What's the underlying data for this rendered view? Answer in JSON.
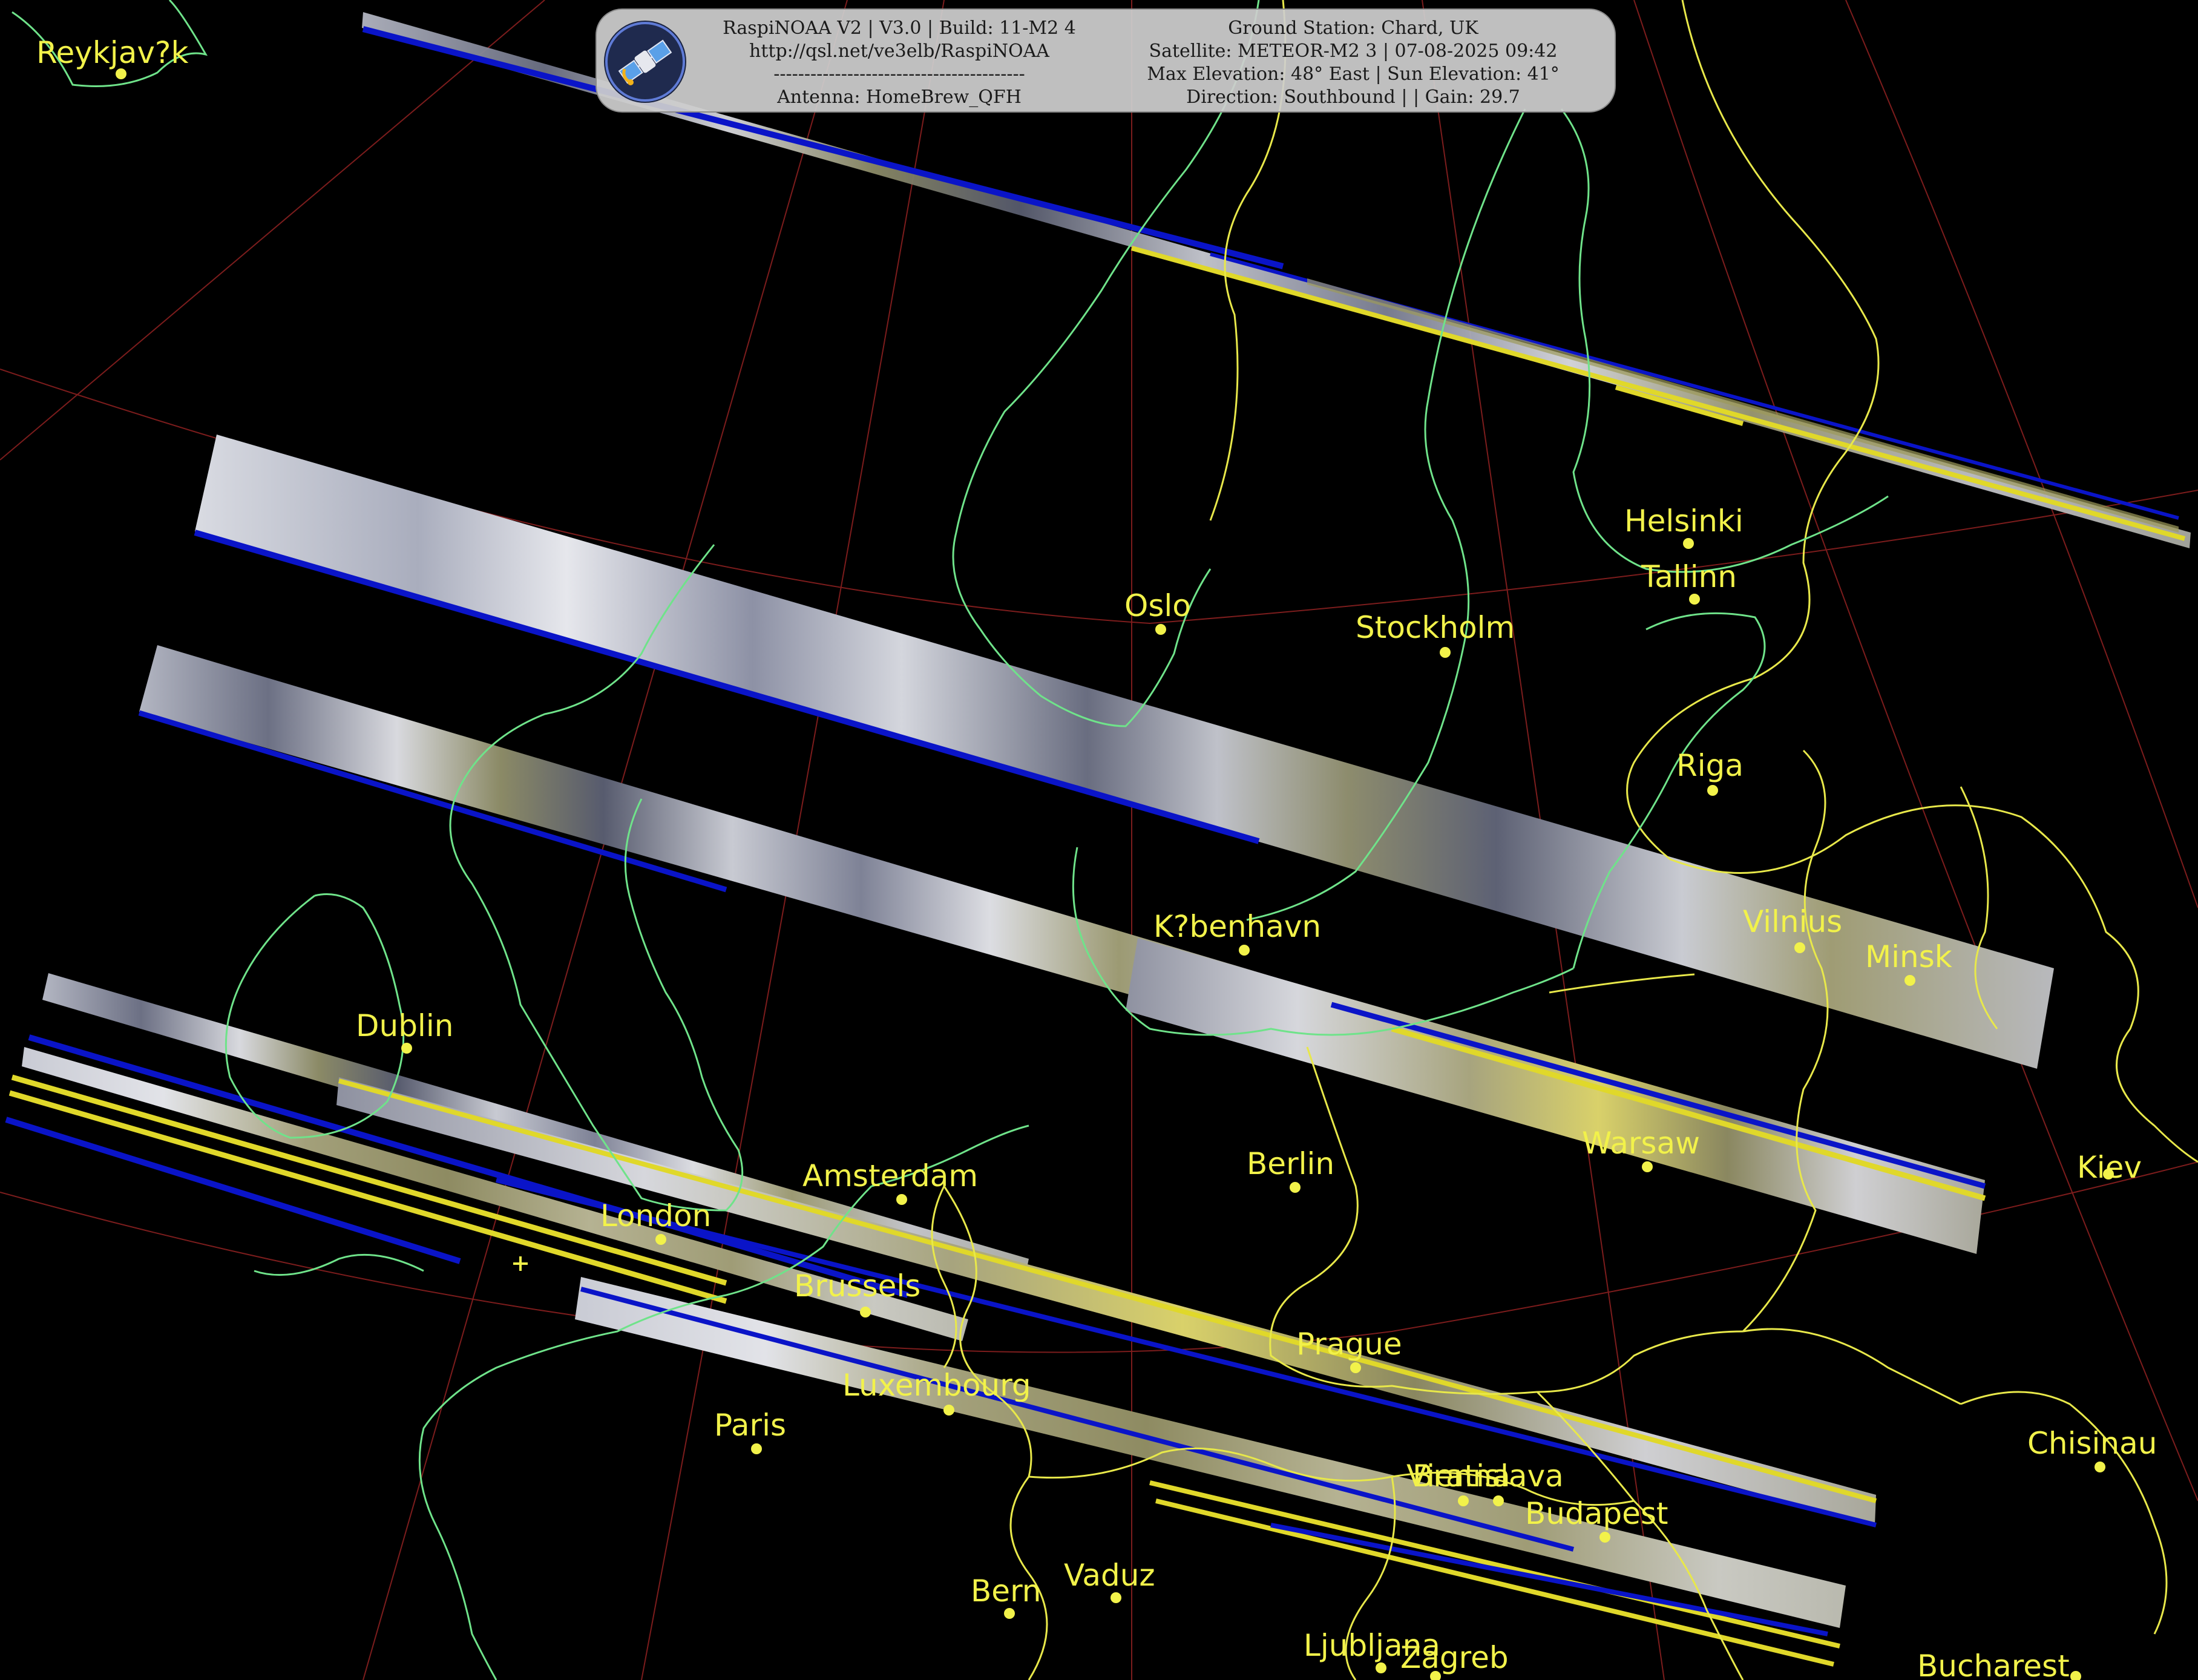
{
  "header": {
    "left_lines": [
      "RaspiNOAA V2 | V3.0 | Build: 11-M2 4",
      "http://qsl.net/ve3elb/RaspiNOAA",
      "-----------------------------------------",
      "Antenna: HomeBrew_QFH"
    ],
    "right_lines": [
      "Ground Station: Chard, UK",
      "Satellite: METEOR-M2 3 | 07-08-2025 09:42",
      "Max Elevation: 48° East | Sun Elevation: 41°",
      "Direction: Southbound | | Gain: 29.7"
    ],
    "logo_icon": "satellite-icon"
  },
  "cities": [
    "Reykjav?k",
    "Helsinki",
    "Tallinn",
    "Oslo",
    "Stockholm",
    "Riga",
    "K?benhavn",
    "Vilnius",
    "Minsk",
    "Dublin",
    "Amsterdam",
    "Berlin",
    "Warsaw",
    "Kiev",
    "London",
    "Brussels",
    "Prague",
    "Luxembourg",
    "Paris",
    "Chisinau",
    "Vienna",
    "Bratislava",
    "Budapest",
    "Bern",
    "Vaduz",
    "Ljubljana",
    "Zagreb",
    "Bucharest"
  ],
  "colors": {
    "background": "#000000",
    "coastline": "#6fe38a",
    "borders": "#e8e84a",
    "graticule": "#8a2020",
    "labels": "#f2f24a",
    "scan_cloud": "#cfd3dc",
    "scan_clear": "#5a5f72",
    "scan_land": "#8c8a60",
    "scan_edge_blue": "#0a14c8",
    "scan_edge_yellow": "#e0d82a"
  }
}
